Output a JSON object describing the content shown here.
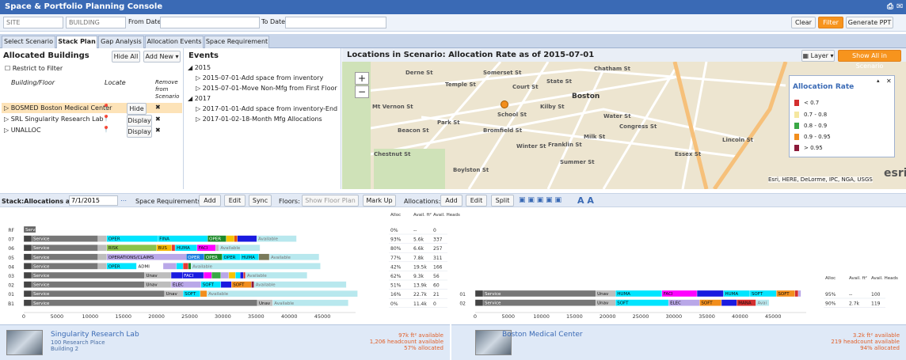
{
  "app": {
    "title": "Space & Portfolio Planning Console"
  },
  "filters": {
    "site_placeholder": "SITE",
    "building_placeholder": "BUILDING",
    "from_label": "From Date:",
    "to_label": "To Date:",
    "clear": "Clear",
    "filter": "Filter",
    "generate": "Generate PPT"
  },
  "tabs": [
    "Select Scenario",
    "Stack Plan",
    "Gap Analysis",
    "Allocation Events",
    "Space Requirement"
  ],
  "allocated": {
    "title": "Allocated Buildings",
    "hide_all": "Hide All",
    "add_new": "Add New",
    "restrict": "Restrict to Filter",
    "col_building": "Building/Floor",
    "col_locate": "Locate",
    "col_remove": "Remove from Scenario",
    "rows": [
      {
        "name": "BOSMED Boston Medical Center",
        "action": "Hide"
      },
      {
        "name": "SRL Singularity Research Lab",
        "action": "Display"
      },
      {
        "name": "UNALLOC",
        "action": "Display"
      }
    ]
  },
  "events": {
    "title": "Events",
    "groups": [
      {
        "year": "2015",
        "items": [
          "2015-07-01-Add space from inventory",
          "2015-07-01-Move Non-Mfg from First Floor"
        ]
      },
      {
        "year": "2017",
        "items": [
          "2017-01-01-Add space from inventory-End",
          "2017-01-02-18-Month Mfg Allocations"
        ]
      }
    ]
  },
  "map": {
    "title": "Locations in Scenario: Allocation Rate as of 2015-07-01",
    "layer": "Layer",
    "show_all": "Show All in Scenario",
    "city": "Boston",
    "attribution": "Esri, HERE, DeLorme, IPC, NGA, USGS",
    "esri": "esri",
    "streets": [
      "Derne St",
      "Temple St",
      "Somerset St",
      "Court St",
      "State St",
      "Kilby St",
      "Chatham St",
      "Water St",
      "Congress St",
      "Milk St",
      "Franklin St",
      "Summer St",
      "Winter St",
      "Beacon St",
      "Park St",
      "School St",
      "Bromfield St",
      "Mt Vernon St",
      "Chestnut St",
      "Essex St",
      "Lincoln St",
      "Boylston St"
    ],
    "legend": {
      "title": "Allocation Rate",
      "items": [
        {
          "label": "< 0.7",
          "color": "#d32f2f"
        },
        {
          "label": "0.7 - 0.8",
          "color": "#f5e7a0"
        },
        {
          "label": "0.8 - 0.9",
          "color": "#3aa845"
        },
        {
          "label": "0.9 - 0.95",
          "color": "#f28e1c"
        },
        {
          "label": "> 0.95",
          "color": "#8b1a3a"
        }
      ]
    }
  },
  "stack": {
    "label": "Stack:Allocations as of:",
    "date": "7/1/2015",
    "space_req": "Space Requirements:",
    "add": "Add",
    "edit": "Edit",
    "sync": "Sync",
    "floors": "Floors:",
    "show_floor": "Show Floor Plan",
    "markup": "Mark Up",
    "allocations": "Allocations:",
    "split": "Split"
  },
  "chart_data": [
    {
      "type": "bar",
      "building": "Singularity Research Lab",
      "headers": [
        "Alloc",
        "Avail. ft²",
        "Avail. Heads"
      ],
      "floors": [
        {
          "floor": "RF",
          "alloc": "0%",
          "avail": "--",
          "heads": "0",
          "segments": [
            {
              "label": "Service",
              "value": 1800,
              "color": "#666666"
            }
          ]
        },
        {
          "floor": "07",
          "alloc": "93%",
          "avail": "5.6k",
          "heads": "337",
          "segments": [
            {
              "label": "Vert",
              "value": 1200,
              "color": "#444444"
            },
            {
              "label": "Service",
              "value": 10000,
              "color": "#777777"
            },
            {
              "label": "Unav",
              "value": 1300,
              "color": "#bdbdbd"
            },
            {
              "label": "OPER",
              "value": 7700,
              "color": "#00e5ff"
            },
            {
              "label": "FINA",
              "value": 7500,
              "color": "#00e5ff"
            },
            {
              "label": "OPER",
              "value": 2800,
              "color": "#1b8a2a"
            },
            {
              "label": "BUS",
              "value": 1200,
              "color": "#f5c400"
            },
            {
              "label": "",
              "value": 500,
              "color": "#e65100"
            },
            {
              "label": "",
              "value": 2900,
              "color": "#1a1ae0"
            },
            {
              "label": "Available",
              "value": 6000,
              "color": "#b8e8ee"
            }
          ]
        },
        {
          "floor": "06",
          "alloc": "80%",
          "avail": "6.6k",
          "heads": "257",
          "segments": [
            {
              "label": "Vert",
              "value": 1200,
              "color": "#444444"
            },
            {
              "label": "Service",
              "value": 10000,
              "color": "#777777"
            },
            {
              "label": "Unav",
              "value": 1300,
              "color": "#bdbdbd"
            },
            {
              "label": "RISK",
              "value": 7500,
              "color": "#8bc34a"
            },
            {
              "label": "BUS",
              "value": 2300,
              "color": "#f5b800"
            },
            {
              "label": "",
              "value": 500,
              "color": "#e53935"
            },
            {
              "label": "HUMA",
              "value": 3300,
              "color": "#00e5ff"
            },
            {
              "label": "FACI",
              "value": 2800,
              "color": "#ff00ff"
            },
            {
              "label": "",
              "value": 500,
              "color": "#bdbdbd"
            },
            {
              "label": "Available",
              "value": 6200,
              "color": "#b8e8ee"
            }
          ]
        },
        {
          "floor": "05",
          "alloc": "77%",
          "avail": "7.8k",
          "heads": "311",
          "segments": [
            {
              "label": "Vert",
              "value": 1200,
              "color": "#444444"
            },
            {
              "label": "Service",
              "value": 10000,
              "color": "#777777"
            },
            {
              "label": "Unav",
              "value": 1300,
              "color": "#bdbdbd"
            },
            {
              "label": "OPERATIONS/CLAIMS",
              "value": 12000,
              "color": "#b9a7e8"
            },
            {
              "label": "OPER",
              "value": 2700,
              "color": "#1a7de0"
            },
            {
              "label": "OPER",
              "value": 2700,
              "color": "#1b8a2a"
            },
            {
              "label": "OPER",
              "value": 2700,
              "color": "#00e5ff"
            },
            {
              "label": "HUMA",
              "value": 2800,
              "color": "#00e5ff"
            },
            {
              "label": "",
              "value": 1600,
              "color": "#7a7a5a"
            },
            {
              "label": "Available",
              "value": 7500,
              "color": "#b8e8ee"
            }
          ]
        },
        {
          "floor": "04",
          "alloc": "42%",
          "avail": "19.5k",
          "heads": "166",
          "segments": [
            {
              "label": "Vert",
              "value": 1200,
              "color": "#444444"
            },
            {
              "label": "Service",
              "value": 10000,
              "color": "#777777"
            },
            {
              "label": "Unav",
              "value": 1300,
              "color": "#bdbdbd"
            },
            {
              "label": "OPER",
              "value": 4500,
              "color": "#00e5ff"
            },
            {
              "label": "ADMI",
              "value": 4000,
              "color": "#ffffff"
            },
            {
              "label": "",
              "value": 2000,
              "color": "#b9a7e8"
            },
            {
              "label": "",
              "value": 1000,
              "color": "#00e5ff"
            },
            {
              "label": "",
              "value": 800,
              "color": "#e53935"
            },
            {
              "label": "",
              "value": 400,
              "color": "#1b8a2a"
            },
            {
              "label": "Available",
              "value": 19500,
              "color": "#b8e8ee"
            }
          ]
        },
        {
          "floor": "03",
          "alloc": "62%",
          "avail": "9.3k",
          "heads": "56",
          "segments": [
            {
              "label": "Vert",
              "value": 1200,
              "color": "#444444"
            },
            {
              "label": "Service",
              "value": 17000,
              "color": "#777777"
            },
            {
              "label": "Unav",
              "value": 4000,
              "color": "#bdbdbd"
            },
            {
              "label": "",
              "value": 1700,
              "color": "#1a1ae0"
            },
            {
              "label": "FACI",
              "value": 3200,
              "color": "#1a1ae0"
            },
            {
              "label": "",
              "value": 1200,
              "color": "#ff00ff"
            },
            {
              "label": "",
              "value": 1400,
              "color": "#3aa845"
            },
            {
              "label": "",
              "value": 1200,
              "color": "#b9a7e8"
            },
            {
              "label": "",
              "value": 1000,
              "color": "#f5c400"
            },
            {
              "label": "",
              "value": 700,
              "color": "#00e5ff"
            },
            {
              "label": "",
              "value": 500,
              "color": "#1a1ae0"
            },
            {
              "label": "",
              "value": 300,
              "color": "#d32f2f"
            },
            {
              "label": "Available",
              "value": 9300,
              "color": "#b8e8ee"
            }
          ]
        },
        {
          "floor": "02",
          "alloc": "51%",
          "avail": "13.9k",
          "heads": "60",
          "segments": [
            {
              "label": "Vert",
              "value": 1200,
              "color": "#444444"
            },
            {
              "label": "Service",
              "value": 17000,
              "color": "#777777"
            },
            {
              "label": "Unav",
              "value": 4000,
              "color": "#bdbdbd"
            },
            {
              "label": "ELEC",
              "value": 4500,
              "color": "#b9a7e8"
            },
            {
              "label": "SOFT",
              "value": 3000,
              "color": "#00e5ff"
            },
            {
              "label": "",
              "value": 1600,
              "color": "#1a1ae0"
            },
            {
              "label": "SOFT",
              "value": 3000,
              "color": "#f28e1c"
            },
            {
              "label": "",
              "value": 400,
              "color": "#8b1a3a"
            },
            {
              "label": "Available",
              "value": 13900,
              "color": "#b8e8ee"
            }
          ]
        },
        {
          "floor": "01",
          "alloc": "16%",
          "avail": "22.7k",
          "heads": "21",
          "segments": [
            {
              "label": "Vert",
              "value": 1200,
              "color": "#444444"
            },
            {
              "label": "Service",
              "value": 20000,
              "color": "#777777"
            },
            {
              "label": "Unav",
              "value": 2800,
              "color": "#bdbdbd"
            },
            {
              "label": "SOFT",
              "value": 2600,
              "color": "#00e5ff"
            },
            {
              "label": "",
              "value": 1000,
              "color": "#f28e1c"
            },
            {
              "label": "Available",
              "value": 22700,
              "color": "#b8e8ee"
            }
          ]
        },
        {
          "floor": "B1",
          "alloc": "0%",
          "avail": "11.4k",
          "heads": "0",
          "segments": [
            {
              "label": "Vert",
              "value": 1200,
              "color": "#444444"
            },
            {
              "label": "Service",
              "value": 34000,
              "color": "#777777"
            },
            {
              "label": "Unav",
              "value": 2300,
              "color": "#bdbdbd"
            },
            {
              "label": "Available",
              "value": 11400,
              "color": "#b8e8ee"
            }
          ]
        }
      ],
      "xlim": [
        0,
        50000
      ],
      "ticks": [
        0,
        5000,
        10000,
        15000,
        20000,
        25000,
        30000,
        35000,
        40000,
        45000
      ]
    },
    {
      "type": "bar",
      "building": "Boston Medical Center",
      "headers": [
        "Alloc",
        "Avail. ft²",
        "Avail. Heads"
      ],
      "floors": [
        {
          "floor": "01",
          "alloc": "95%",
          "avail": "--",
          "heads": "100",
          "segments": [
            {
              "label": "Vert",
              "value": 1200,
              "color": "#444444"
            },
            {
              "label": "Service",
              "value": 17000,
              "color": "#777777"
            },
            {
              "label": "Unav",
              "value": 3000,
              "color": "#bdbdbd"
            },
            {
              "label": "HUMA",
              "value": 7000,
              "color": "#00e5ff"
            },
            {
              "label": "FACI",
              "value": 5300,
              "color": "#ff00ff"
            },
            {
              "label": "",
              "value": 4000,
              "color": "#1a1ae0"
            },
            {
              "label": "HUMA",
              "value": 4000,
              "color": "#00e5ff"
            },
            {
              "label": "SOFT",
              "value": 4000,
              "color": "#00e5ff"
            },
            {
              "label": "SOFT",
              "value": 2800,
              "color": "#f28e1c"
            },
            {
              "label": "",
              "value": 500,
              "color": "#d32f2f"
            },
            {
              "label": "",
              "value": 400,
              "color": "#b9a7e8"
            }
          ]
        },
        {
          "floor": "02",
          "alloc": "90%",
          "avail": "2.7k",
          "heads": "119",
          "segments": [
            {
              "label": "Vert",
              "value": 1200,
              "color": "#444444"
            },
            {
              "label": "Service",
              "value": 17000,
              "color": "#777777"
            },
            {
              "label": "Unav",
              "value": 3000,
              "color": "#bdbdbd"
            },
            {
              "label": "SOFT",
              "value": 8000,
              "color": "#00e5ff"
            },
            {
              "label": "ELEC",
              "value": 4700,
              "color": "#b9a7e8"
            },
            {
              "label": "SOFT",
              "value": 3300,
              "color": "#f28e1c"
            },
            {
              "label": "",
              "value": 2300,
              "color": "#1a1ae0"
            },
            {
              "label": "MANA",
              "value": 2900,
              "color": "#d32f2f"
            },
            {
              "label": "Avai",
              "value": 2000,
              "color": "#b8e8ee"
            }
          ]
        }
      ],
      "xlim": [
        0,
        50000
      ],
      "ticks": [
        0,
        5000,
        10000,
        15000,
        20000,
        25000,
        30000,
        35000,
        40000,
        45000
      ]
    }
  ],
  "footers": [
    {
      "title": "Singularity Research Lab",
      "address": "100 Research Place",
      "sub": "Building 2",
      "stats": [
        "97k ft² available",
        "1,206 headcount available",
        "57% allocated"
      ]
    },
    {
      "title": "Boston Medical Center",
      "address": "",
      "sub": "",
      "stats": [
        "3.2k ft² available",
        "219 headcount available",
        "94% allocated"
      ]
    }
  ]
}
